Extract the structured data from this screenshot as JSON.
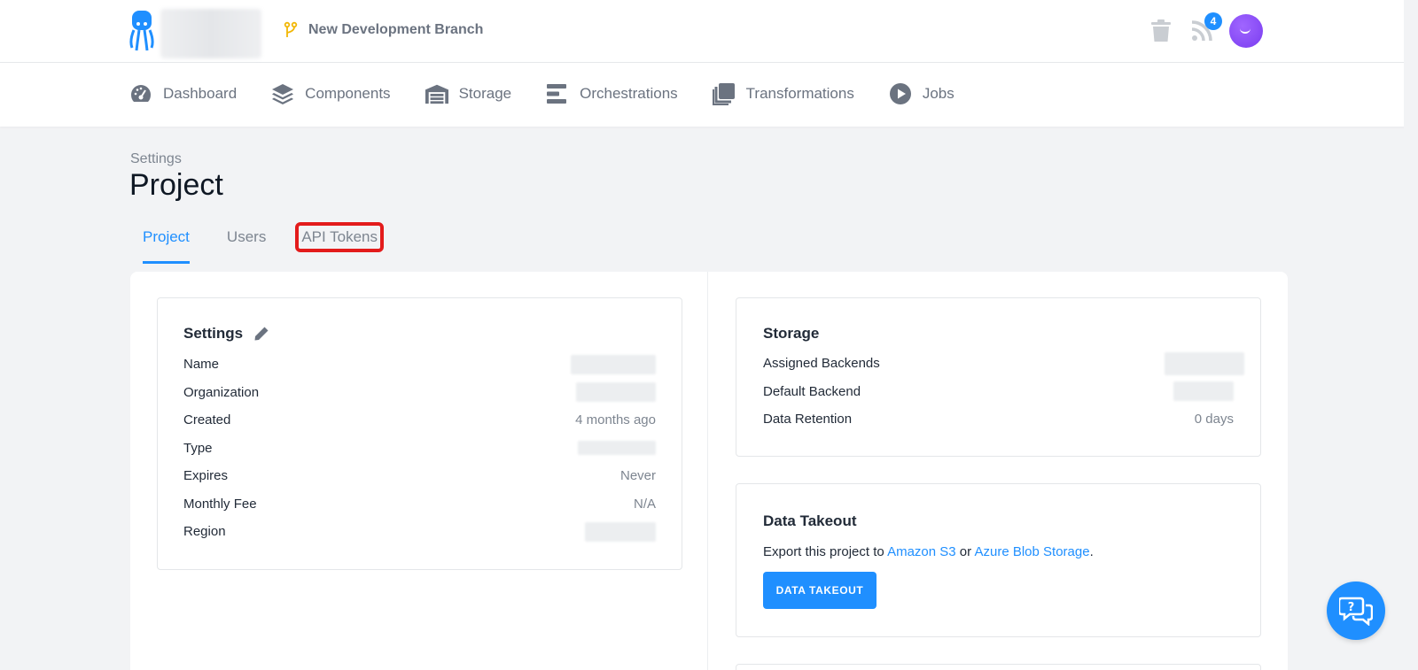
{
  "header": {
    "branch_name": "New Development Branch",
    "notifications_count": "4"
  },
  "nav": {
    "items": [
      {
        "label": "Dashboard",
        "icon": "dashboard-icon"
      },
      {
        "label": "Components",
        "icon": "layers-icon"
      },
      {
        "label": "Storage",
        "icon": "warehouse-icon"
      },
      {
        "label": "Orchestrations",
        "icon": "bars-icon"
      },
      {
        "label": "Transformations",
        "icon": "copy-icon"
      },
      {
        "label": "Jobs",
        "icon": "play-icon"
      }
    ]
  },
  "page": {
    "breadcrumb": "Settings",
    "title": "Project"
  },
  "tabs": [
    {
      "label": "Project",
      "active": true
    },
    {
      "label": "Users",
      "active": false
    },
    {
      "label": "API Tokens",
      "active": false,
      "highlighted": true
    }
  ],
  "settings_card": {
    "title": "Settings",
    "rows": [
      {
        "key": "Name",
        "value": ""
      },
      {
        "key": "Organization",
        "value": ""
      },
      {
        "key": "Created",
        "value": "4 months ago"
      },
      {
        "key": "Type",
        "value": ""
      },
      {
        "key": "Expires",
        "value": "Never"
      },
      {
        "key": "Monthly Fee",
        "value": "N/A"
      },
      {
        "key": "Region",
        "value": ""
      }
    ]
  },
  "storage_card": {
    "title": "Storage",
    "rows": [
      {
        "key": "Assigned Backends",
        "value": ""
      },
      {
        "key": "Default Backend",
        "value": ""
      },
      {
        "key": "Data Retention",
        "value": "0 days"
      }
    ]
  },
  "takeout_card": {
    "title": "Data Takeout",
    "desc_prefix": "Export this project to ",
    "link_s3": "Amazon S3",
    "desc_or": " or ",
    "link_azure": "Azure Blob Storage",
    "desc_suffix": ".",
    "button_label": "DATA TAKEOUT"
  },
  "colors": {
    "accent": "#1f8fff",
    "highlight_border": "#e31b1b",
    "avatar": "#8a4dff"
  }
}
